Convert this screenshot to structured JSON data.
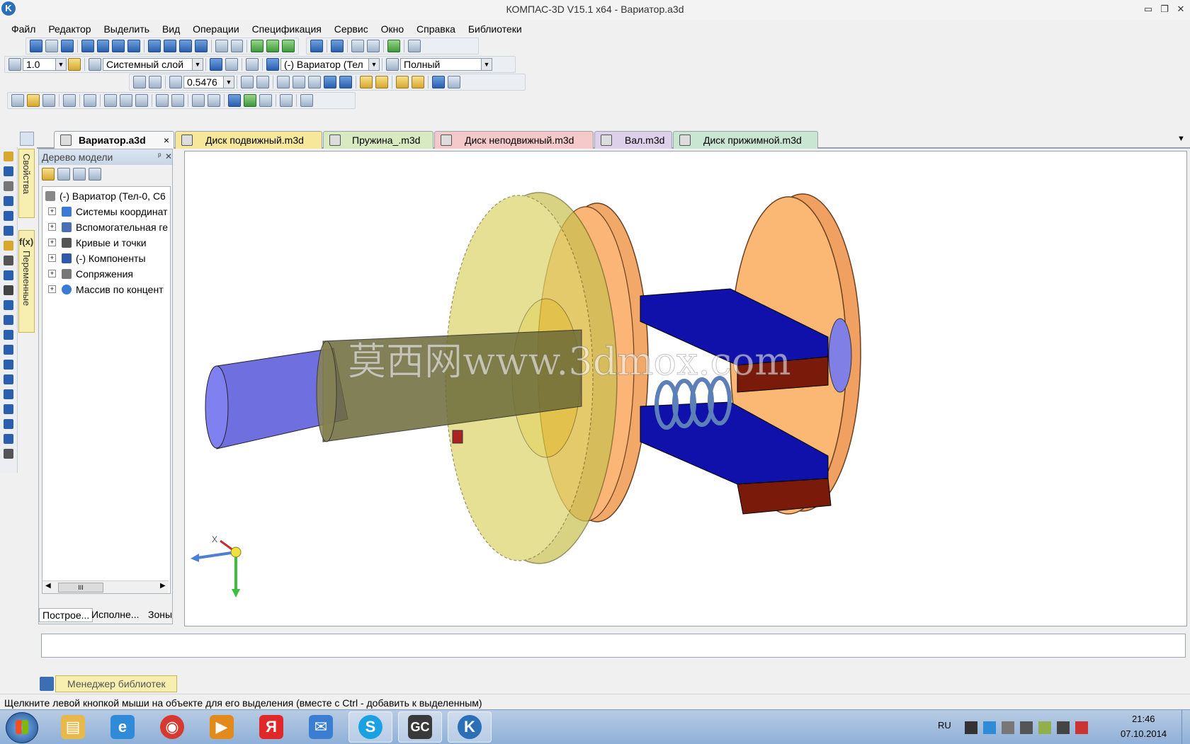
{
  "window": {
    "title": "КОМПАС-3D V15.1 x64 - Вариатор.a3d",
    "logo_text": "K",
    "min_glyph": "▭",
    "restore_glyph": "❐",
    "close_glyph": "✕"
  },
  "menu": [
    "Файл",
    "Редактор",
    "Выделить",
    "Вид",
    "Операции",
    "Спецификация",
    "Сервис",
    "Окно",
    "Справка",
    "Библиотеки"
  ],
  "toolbars": {
    "step_value": "1.0",
    "layer_value": "Системный слой",
    "component_value": "(-) Вариатор (Тел",
    "render_mode_value": "Полный",
    "zoom_value": "0.5476"
  },
  "doc_tabs": [
    {
      "label": "Вариатор.a3d",
      "color": "#f0f0f0",
      "active": true,
      "close": "×"
    },
    {
      "label": "Диск подвижный.m3d",
      "color": "#f6e79a"
    },
    {
      "label": "Пружина_.m3d",
      "color": "#d8ebc0"
    },
    {
      "label": "Диск неподвижный.m3d",
      "color": "#f5c9c9"
    },
    {
      "label": "Вал.m3d",
      "color": "#ddd0ea"
    },
    {
      "label": "Диск прижимной.m3d",
      "color": "#c9e6d2"
    }
  ],
  "tabs_menu_glyph": "▼",
  "side_tabs": {
    "properties": "Свойства",
    "variables": "Переменные",
    "fx": "f(x)"
  },
  "model_tree": {
    "header": "Дерево модели",
    "pin_glyph": "ᵖ",
    "close_glyph": "✕",
    "root": "(-) Вариатор (Тел-0, С6",
    "items": [
      {
        "label": "Системы координат",
        "icon": "coordinate-systems-icon",
        "color": "#3a7bd5"
      },
      {
        "label": "Вспомогательная ге",
        "icon": "auxiliary-geometry-icon",
        "color": "#4a6fb5"
      },
      {
        "label": "Кривые и точки",
        "icon": "curves-points-icon",
        "color": "#555555"
      },
      {
        "label": "(-) Компоненты",
        "icon": "components-icon",
        "color": "#2e5aa8"
      },
      {
        "label": "Сопряжения",
        "icon": "mates-icon",
        "color": "#777777"
      },
      {
        "label": "Массив по концент",
        "icon": "circular-array-icon",
        "color": "#3a7bd5"
      }
    ],
    "scroll_thumb": "III",
    "bottom_tabs": [
      "Построе...",
      "Исполне...",
      "Зоны"
    ]
  },
  "viewport": {
    "watermark": "莫西网www.3dmox.com",
    "axis_x_label": "X"
  },
  "library_manager": "Менеджер библиотек",
  "status_text": "Щелкните левой кнопкой мыши на объекте для его выделения (вместе с Ctrl - добавить к выделенным)",
  "taskbar": {
    "apps": [
      {
        "name": "explorer",
        "glyph": "▤",
        "color": "#e8b94a"
      },
      {
        "name": "ie",
        "glyph": "e",
        "color": "#2f8ad8"
      },
      {
        "name": "chrome",
        "glyph": "◉",
        "color": "#d6392f"
      },
      {
        "name": "media",
        "glyph": "▶",
        "color": "#e38a1d"
      },
      {
        "name": "yandex",
        "glyph": "Я",
        "color": "#e02828"
      },
      {
        "name": "mail",
        "glyph": "✉",
        "color": "#3b7dd0"
      },
      {
        "name": "skype",
        "glyph": "S",
        "color": "#1ba1e2"
      },
      {
        "name": "gc",
        "glyph": "GC",
        "color": "#3a3a3a"
      },
      {
        "name": "kompas",
        "glyph": "K",
        "color": "#2b6fb6"
      }
    ],
    "lang": "RU",
    "time": "21:46",
    "date": "07.10.2014"
  }
}
